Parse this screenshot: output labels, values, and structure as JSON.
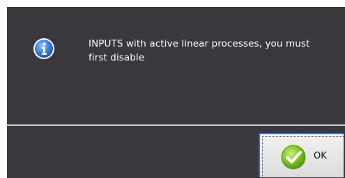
{
  "dialog": {
    "message": "INPUTS with active linear processes, you must first disable",
    "icon": "info-icon",
    "ok_button": {
      "label": "OK",
      "icon": "check-icon"
    }
  },
  "colors": {
    "background": "#3a383d",
    "separator": "#cfcfcf",
    "info_icon": "#3d7fe0",
    "check_icon": "#7cc225",
    "focus_border": "#2b6fd4"
  }
}
